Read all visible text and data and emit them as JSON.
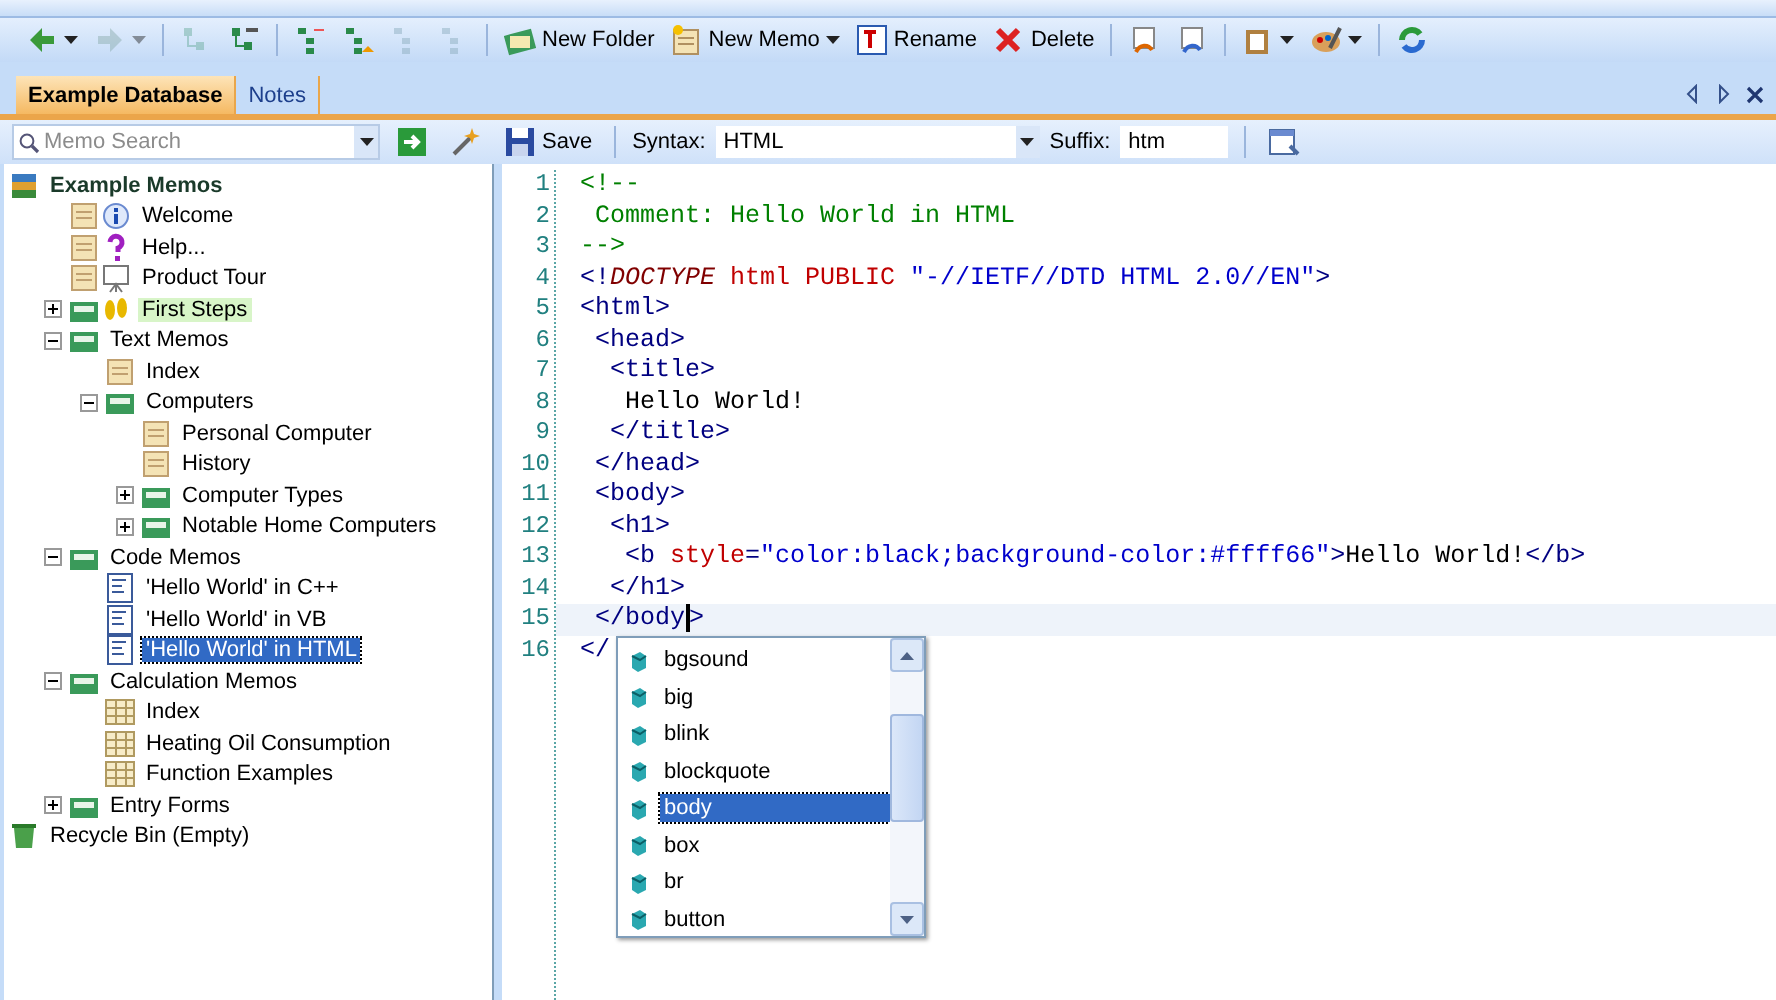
{
  "toolbar": [
    {
      "disabled": false,
      "dropdown": true
    },
    {
      "disabled": true,
      "dropdown": true
    },
    {
      "disabled": true,
      "dropdown": false
    },
    {
      "disabled": false,
      "dropdown": false
    },
    {
      "disabled": false,
      "dropdown": false
    },
    {
      "disabled": false,
      "dropdown": false
    },
    {
      "disabled": true,
      "dropdown": false
    },
    {
      "disabled": true,
      "dropdown": false
    },
    {
      "label": "New Folder",
      "disabled": false,
      "dropdown": false
    },
    {
      "label": "New Memo",
      "disabled": false,
      "dropdown": true
    },
    {
      "label": "Rename",
      "disabled": false,
      "dropdown": false
    },
    {
      "label": "Delete",
      "disabled": false,
      "dropdown": false
    },
    {
      "disabled": false,
      "dropdown": false
    },
    {
      "disabled": false,
      "dropdown": false
    },
    {
      "disabled": false,
      "dropdown": true
    },
    {
      "disabled": false,
      "dropdown": true
    },
    {
      "disabled": false,
      "dropdown": false
    }
  ],
  "tabs": [
    {
      "label": "Example Database",
      "selected": true
    },
    {
      "label": "Notes",
      "selected": false
    }
  ],
  "memo_toolbar": {
    "search": {
      "placeholder": "Memo Search"
    },
    "save": "Save",
    "syntax_label": "Syntax:",
    "syntax": "HTML",
    "suffix_label": "Suffix:",
    "suffix": "htm"
  },
  "tree": [
    {
      "label": "Example Memos",
      "kind": "root",
      "selected": false,
      "highlighted": false,
      "children": [
        {
          "label": "Welcome",
          "kind": "info",
          "selected": false,
          "highlighted": false
        },
        {
          "label": "Help...",
          "kind": "help",
          "selected": false,
          "highlighted": false
        },
        {
          "label": "Product Tour",
          "kind": "tour",
          "selected": false,
          "highlighted": false
        },
        {
          "label": "First Steps",
          "kind": "steps",
          "expanded": false,
          "selected": false,
          "highlighted": true
        },
        {
          "label": "Text Memos",
          "kind": "folder",
          "expanded": true,
          "selected": false,
          "highlighted": false,
          "children": [
            {
              "label": "Index",
              "kind": "memo",
              "selected": false,
              "highlighted": false
            },
            {
              "label": "Computers",
              "kind": "folder",
              "expanded": true,
              "selected": false,
              "highlighted": false,
              "children": [
                {
                  "label": "Personal Computer",
                  "kind": "memo",
                  "selected": false,
                  "highlighted": false
                },
                {
                  "label": "History",
                  "kind": "memo",
                  "selected": false,
                  "highlighted": false
                },
                {
                  "label": "Computer Types",
                  "kind": "folder",
                  "expanded": false,
                  "selected": false,
                  "highlighted": false
                },
                {
                  "label": "Notable Home Computers",
                  "kind": "folder",
                  "expanded": false,
                  "selected": false,
                  "highlighted": false
                }
              ]
            }
          ]
        },
        {
          "label": "Code Memos",
          "kind": "folder",
          "expanded": true,
          "selected": false,
          "highlighted": false,
          "children": [
            {
              "label": "'Hello World' in C++",
              "kind": "code",
              "selected": false,
              "highlighted": false
            },
            {
              "label": "'Hello World' in VB",
              "kind": "code",
              "selected": false,
              "highlighted": false
            },
            {
              "label": "'Hello World' in HTML",
              "kind": "code",
              "selected": true,
              "highlighted": false
            }
          ]
        },
        {
          "label": "Calculation Memos",
          "kind": "folder",
          "expanded": true,
          "selected": false,
          "highlighted": false,
          "children": [
            {
              "label": "Index",
              "kind": "calc",
              "selected": false,
              "highlighted": false
            },
            {
              "label": "Heating Oil Consumption",
              "kind": "calc",
              "selected": false,
              "highlighted": false
            },
            {
              "label": "Function Examples",
              "kind": "calc",
              "selected": false,
              "highlighted": false
            }
          ]
        },
        {
          "label": "Entry Forms",
          "kind": "folder",
          "expanded": false,
          "selected": false,
          "highlighted": false
        }
      ]
    },
    {
      "label": "Recycle Bin (Empty)",
      "kind": "bin",
      "selected": false,
      "highlighted": false
    }
  ],
  "editor": {
    "lines": [
      {
        "number": "1",
        "current": false,
        "segments": [
          {
            "kind": "comment",
            "text": "<!--"
          }
        ]
      },
      {
        "number": "2",
        "current": false,
        "segments": [
          {
            "kind": "comment",
            "text": " Comment: Hello World in HTML"
          }
        ]
      },
      {
        "number": "3",
        "current": false,
        "segments": [
          {
            "kind": "comment",
            "text": "-->"
          }
        ]
      },
      {
        "number": "4",
        "current": false,
        "segments": [
          {
            "kind": "tag",
            "text": "<!"
          },
          {
            "kind": "doctype",
            "text": "DOCTYPE"
          },
          {
            "kind": "attr",
            "text": " html PUBLIC"
          },
          {
            "kind": "string",
            "text": " \"-//IETF//DTD HTML 2.0//EN\""
          },
          {
            "kind": "tag",
            "text": ">"
          }
        ]
      },
      {
        "number": "5",
        "current": false,
        "segments": [
          {
            "kind": "tag",
            "text": "<html>"
          }
        ]
      },
      {
        "number": "6",
        "current": false,
        "segments": [
          {
            "kind": "tag",
            "text": " <head>"
          }
        ]
      },
      {
        "number": "7",
        "current": false,
        "segments": [
          {
            "kind": "tag",
            "text": "  <title>"
          }
        ]
      },
      {
        "number": "8",
        "current": false,
        "segments": [
          {
            "kind": "text",
            "text": "   Hello World!"
          }
        ]
      },
      {
        "number": "9",
        "current": false,
        "segments": [
          {
            "kind": "tag",
            "text": "  </title>"
          }
        ]
      },
      {
        "number": "10",
        "current": false,
        "segments": [
          {
            "kind": "tag",
            "text": " </head>"
          }
        ]
      },
      {
        "number": "11",
        "current": false,
        "segments": [
          {
            "kind": "tag",
            "text": " <body>"
          }
        ]
      },
      {
        "number": "12",
        "current": false,
        "segments": [
          {
            "kind": "tag",
            "text": "  <h1>"
          }
        ]
      },
      {
        "number": "13",
        "current": false,
        "segments": [
          {
            "kind": "tag",
            "text": "   <b"
          },
          {
            "kind": "attr",
            "text": " style"
          },
          {
            "kind": "tag",
            "text": "="
          },
          {
            "kind": "string",
            "text": "\"color:black;background-color:#ffff66\""
          },
          {
            "kind": "tag",
            "text": ">"
          },
          {
            "kind": "text",
            "text": "Hello World!"
          },
          {
            "kind": "tag",
            "text": "</b>"
          }
        ]
      },
      {
        "number": "14",
        "current": false,
        "segments": [
          {
            "kind": "tag",
            "text": "  </h1>"
          }
        ]
      },
      {
        "number": "15",
        "current": true,
        "segments": [
          {
            "kind": "tag",
            "text": " </body",
            "caret": true
          },
          {
            "kind": "tag",
            "text": ">"
          }
        ]
      },
      {
        "number": "16",
        "current": false,
        "segments": [
          {
            "kind": "tag",
            "text": "</"
          }
        ]
      }
    ],
    "completion": {
      "items": [
        {
          "label": "bgsound",
          "selected": false
        },
        {
          "label": "big",
          "selected": false
        },
        {
          "label": "blink",
          "selected": false
        },
        {
          "label": "blockquote",
          "selected": false
        },
        {
          "label": "body",
          "selected": true
        },
        {
          "label": "box",
          "selected": false
        },
        {
          "label": "br",
          "selected": false
        },
        {
          "label": "button",
          "selected": false
        }
      ],
      "scroll": {
        "level": 0.35
      }
    }
  }
}
